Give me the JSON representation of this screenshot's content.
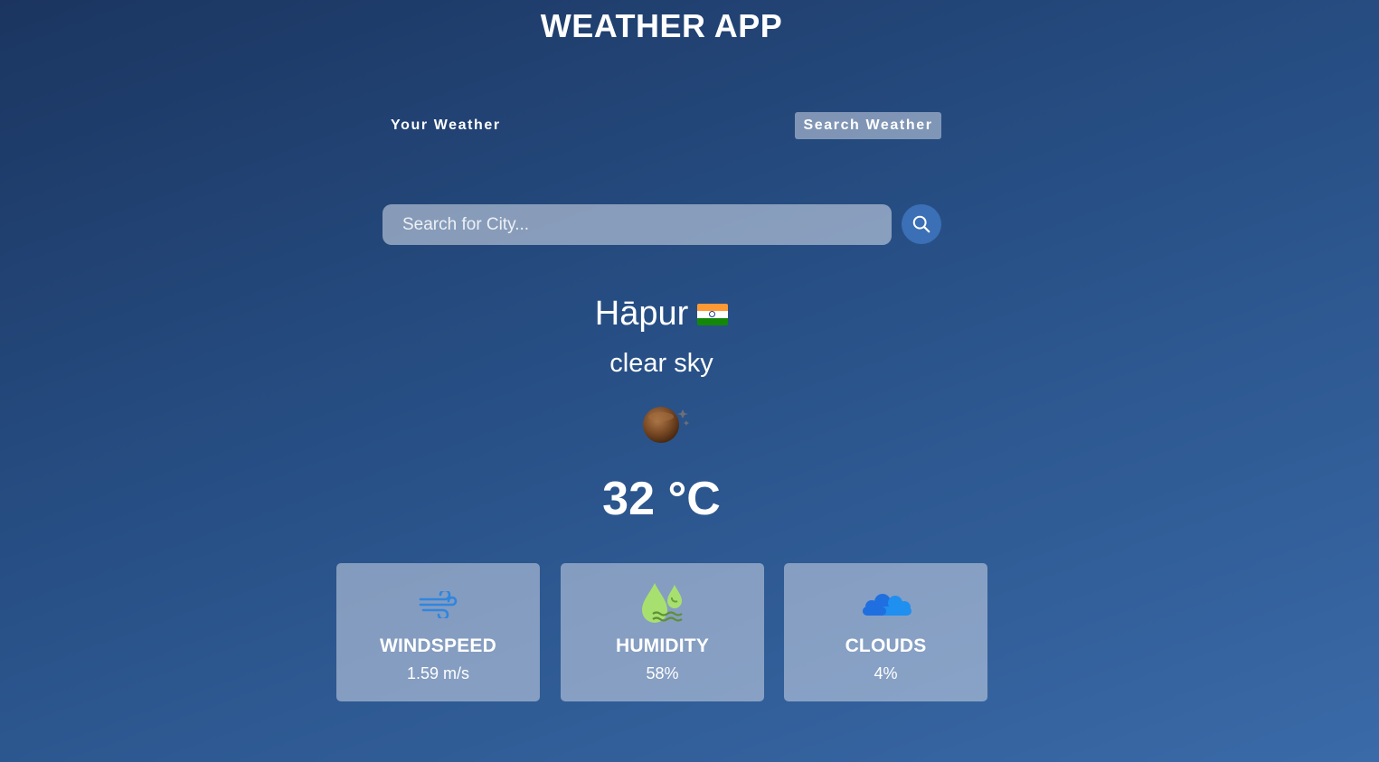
{
  "app": {
    "title": "WEATHER APP"
  },
  "tabs": [
    {
      "label": "Your Weather",
      "active": false
    },
    {
      "label": "Search Weather",
      "active": true
    }
  ],
  "search": {
    "placeholder": "Search for City...",
    "value": "",
    "icon": "search-icon"
  },
  "weather": {
    "city": "Hāpur",
    "country_flag": "india-flag-icon",
    "description": "clear sky",
    "condition_icon": "clear-night-moon-icon",
    "temperature": "32 °C"
  },
  "cards": [
    {
      "label": "WINDSPEED",
      "value": "1.59 m/s",
      "icon": "wind-icon"
    },
    {
      "label": "HUMIDITY",
      "value": "58%",
      "icon": "humidity-drops-icon"
    },
    {
      "label": "CLOUDS",
      "value": "4%",
      "icon": "cloud-icon"
    }
  ],
  "colors": {
    "background_top": "#1b3560",
    "background_bottom": "#3a6aa8",
    "search_button": "#3b6fb6",
    "wind_icon": "#2f86e0",
    "humidity_icon": "#a8e06f",
    "cloud_icon": "#1f8ff0"
  }
}
